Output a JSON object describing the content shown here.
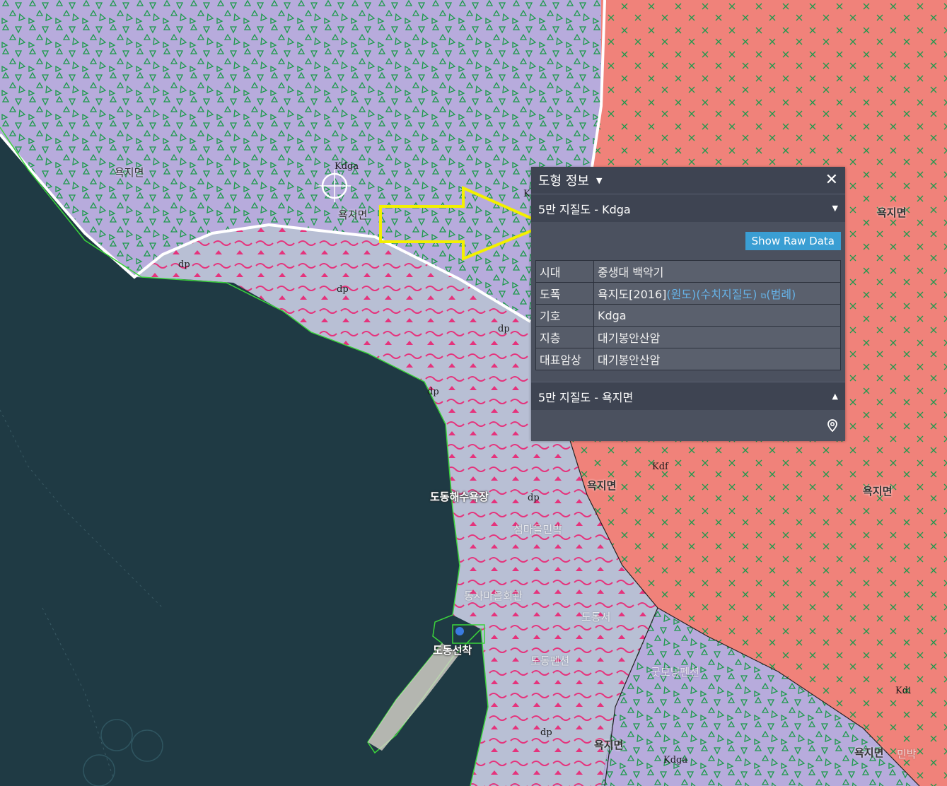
{
  "panel": {
    "title": "도형 정보",
    "close_icon": "close-icon",
    "section1": {
      "header": "5만 지질도 - Kdga",
      "raw_button": "Show Raw Data",
      "rows": [
        {
          "key": "시대",
          "value": "중생대  백악기"
        },
        {
          "key": "도폭",
          "value": "욕지도[2016]",
          "links": [
            "(원도)",
            "(수치지질도)",
            "(범례)"
          ]
        },
        {
          "key": "기호",
          "value": "Kdga"
        },
        {
          "key": "지층",
          "value": "대기봉안산암"
        },
        {
          "key": "대표암상",
          "value": "대기봉안산암"
        }
      ]
    },
    "section2": {
      "header": "5만 지질도 - 욕지면",
      "pin_icon": "location-pin-icon"
    }
  },
  "map": {
    "labels": {
      "yokji1": "욕지면",
      "yokji2": "욕지면",
      "yokji3": "욕지면",
      "yokji4": "욕지면",
      "yokji5": "욕지면",
      "yokji6": "욕지면",
      "yokji7": "욕지면",
      "dodong_beach": "도동해수욕장",
      "dodong_pier": "도동선착",
      "minbak": "섬마을민박",
      "village_hall": "동사마을회관",
      "dodong_seo": "도동서",
      "pension1": "도동펜션",
      "pension2": "굿모닝펜션",
      "minbak2": "민박"
    },
    "codes": {
      "kdga_top": "Kdga",
      "kdga_bottom": "Kdga",
      "kdf": "Kdf",
      "kdi": "Kdi",
      "k_edge": "K",
      "dp1": "dp",
      "dp2": "dp",
      "dp3": "dp",
      "dp4": "dp",
      "dp5": "dp",
      "dp6": "dp"
    },
    "colors": {
      "kdga_fill": "#b7abdc",
      "kdf_fill": "#f0827a",
      "dp_fill": "#b8bfd4",
      "sea": "#1f3a44",
      "pattern_green": "#1d9a4c",
      "pattern_pink": "#e5337c",
      "arrow_yellow": "#f3f000"
    }
  }
}
